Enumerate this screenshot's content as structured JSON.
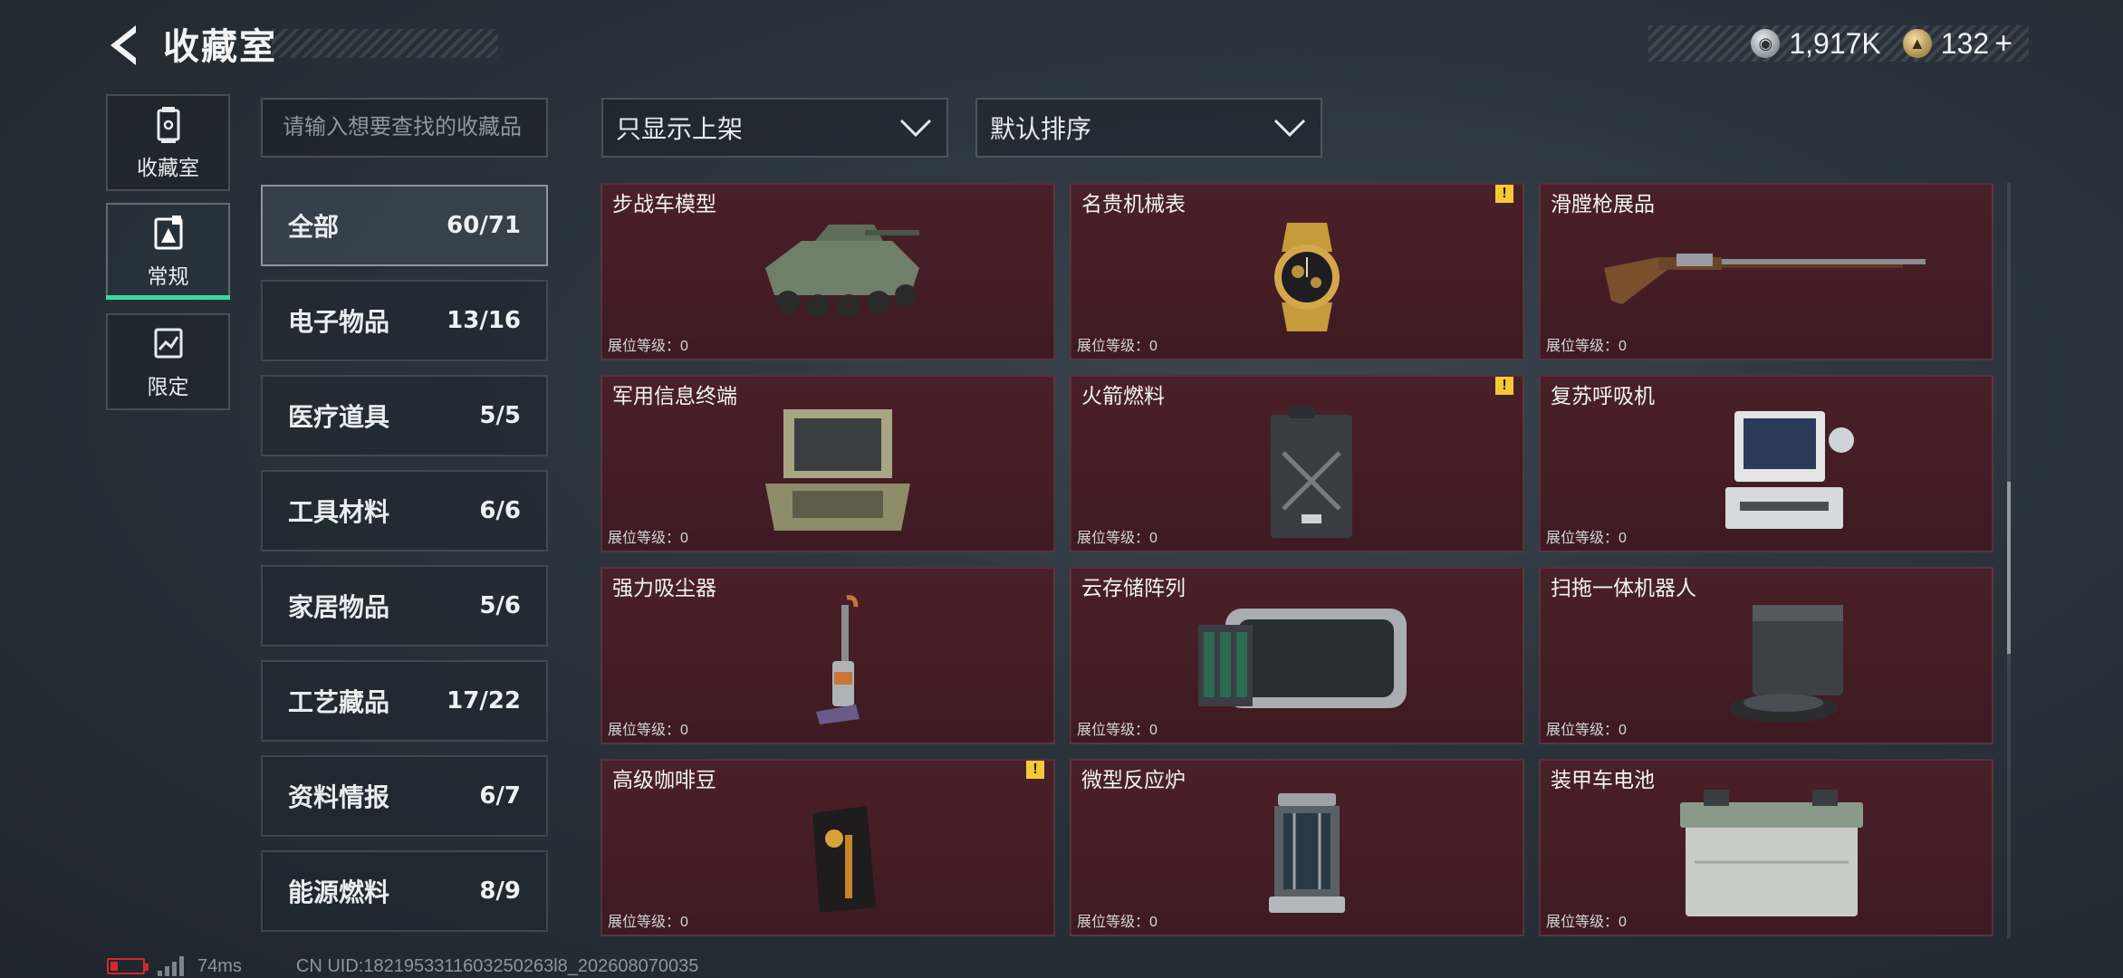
{
  "header": {
    "title": "收藏室",
    "currencies": [
      {
        "icon": "silver-coin-icon",
        "value": "1,917K"
      },
      {
        "icon": "gold-coin-icon",
        "value": "132"
      }
    ],
    "add_label": "+"
  },
  "nav": [
    {
      "label": "收藏室",
      "icon": "collection-room-icon",
      "active": false
    },
    {
      "label": "常规",
      "icon": "regular-icon",
      "active": true
    },
    {
      "label": "限定",
      "icon": "limited-icon",
      "active": false
    }
  ],
  "search": {
    "placeholder": "请输入想要查找的收藏品"
  },
  "filters": {
    "shelf_filter": "只显示上架",
    "sort": "默认排序"
  },
  "categories": [
    {
      "name": "全部",
      "count": "60/71",
      "active": true
    },
    {
      "name": "电子物品",
      "count": "13/16"
    },
    {
      "name": "医疗道具",
      "count": "5/5"
    },
    {
      "name": "工具材料",
      "count": "6/6"
    },
    {
      "name": "家居物品",
      "count": "5/6"
    },
    {
      "name": "工艺藏品",
      "count": "17/22"
    },
    {
      "name": "资料情报",
      "count": "6/7"
    },
    {
      "name": "能源燃料",
      "count": "8/9"
    }
  ],
  "items": [
    {
      "name": "步战车模型",
      "level": "展位等级：0",
      "warning": false,
      "icon": "ifv-model-icon"
    },
    {
      "name": "名贵机械表",
      "level": "展位等级：0",
      "warning": true,
      "icon": "mechanical-watch-icon"
    },
    {
      "name": "滑膛枪展品",
      "level": "展位等级：0",
      "warning": false,
      "icon": "musket-icon"
    },
    {
      "name": "军用信息终端",
      "level": "展位等级：0",
      "warning": false,
      "icon": "military-terminal-icon"
    },
    {
      "name": "火箭燃料",
      "level": "展位等级：0",
      "warning": true,
      "icon": "rocket-fuel-icon"
    },
    {
      "name": "复苏呼吸机",
      "level": "展位等级：0",
      "warning": false,
      "icon": "ventilator-icon"
    },
    {
      "name": "强力吸尘器",
      "level": "展位等级：0",
      "warning": false,
      "icon": "vacuum-cleaner-icon"
    },
    {
      "name": "云存储阵列",
      "level": "展位等级：0",
      "warning": false,
      "icon": "storage-array-icon"
    },
    {
      "name": "扫拖一体机器人",
      "level": "展位等级：0",
      "warning": false,
      "icon": "robot-mop-icon"
    },
    {
      "name": "高级咖啡豆",
      "level": "展位等级：0",
      "warning": true,
      "icon": "coffee-beans-icon"
    },
    {
      "name": "微型反应炉",
      "level": "展位等级：0",
      "warning": false,
      "icon": "micro-reactor-icon"
    },
    {
      "name": "装甲车电池",
      "level": "展位等级：0",
      "warning": false,
      "icon": "vehicle-battery-icon"
    }
  ],
  "warning_glyph": "!",
  "footer": {
    "ping": "74ms",
    "uid": "CN UID:1821953311603250263l8_202608070035"
  },
  "colors": {
    "accent": "#3fd9a0",
    "card_bg": "#4a2028",
    "battery": "#d8262c",
    "warning": "#f5c83a"
  }
}
